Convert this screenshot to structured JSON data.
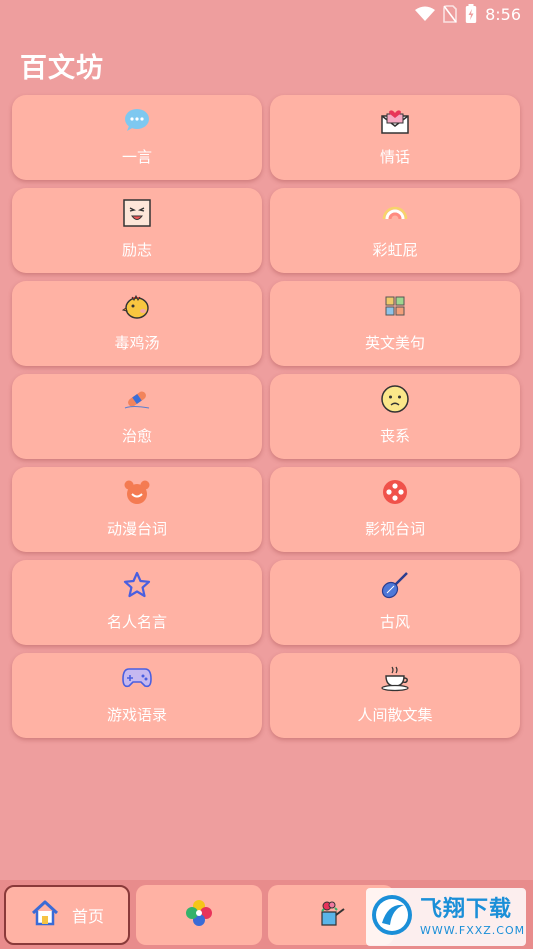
{
  "status": {
    "time": "8:56"
  },
  "title": "百文坊",
  "categories": [
    {
      "label": "一言",
      "icon": "chat-bubble-icon"
    },
    {
      "label": "情话",
      "icon": "love-letter-icon"
    },
    {
      "label": "励志",
      "icon": "cheer-face-icon"
    },
    {
      "label": "彩虹屁",
      "icon": "rainbow-icon"
    },
    {
      "label": "毒鸡汤",
      "icon": "chick-icon"
    },
    {
      "label": "英文美句",
      "icon": "letter-blocks-icon"
    },
    {
      "label": "治愈",
      "icon": "bandage-icon"
    },
    {
      "label": "丧系",
      "icon": "sad-face-icon"
    },
    {
      "label": "动漫台词",
      "icon": "bear-icon"
    },
    {
      "label": "影视台词",
      "icon": "film-reel-icon"
    },
    {
      "label": "名人名言",
      "icon": "star-icon"
    },
    {
      "label": "古风",
      "icon": "pipa-icon"
    },
    {
      "label": "游戏语录",
      "icon": "gamepad-icon"
    },
    {
      "label": "人间散文集",
      "icon": "teacup-icon"
    }
  ],
  "nav": {
    "home_label": "首页"
  },
  "watermark": {
    "main": "飞翔下载",
    "sub": "WWW.FXXZ.COM"
  },
  "colors": {
    "background": "#ee9e9e",
    "card": "#ffb2a4",
    "text": "#ffffff"
  }
}
